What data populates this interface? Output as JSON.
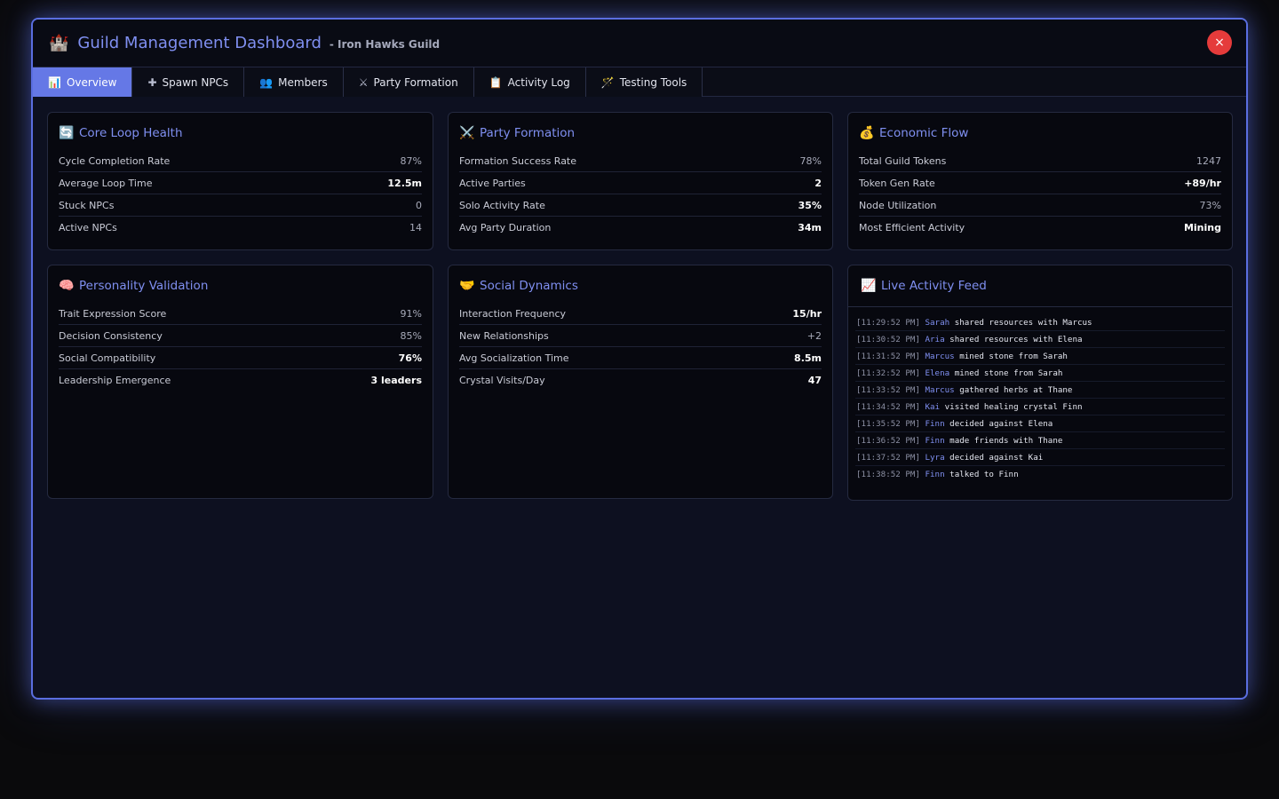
{
  "header": {
    "title": "Guild Management Dashboard",
    "subtitle": "- Iron Hawks Guild",
    "close_label": "×"
  },
  "tabs": [
    {
      "label": "Overview",
      "icon": "chart-icon",
      "active": true
    },
    {
      "label": "Spawn NPCs",
      "icon": "plus-icon"
    },
    {
      "label": "Members",
      "icon": "members-icon"
    },
    {
      "label": "Party Formation",
      "icon": "swords-icon"
    },
    {
      "label": "Activity Log",
      "icon": "clipboard-icon"
    },
    {
      "label": "Testing Tools",
      "icon": "wand-icon"
    }
  ],
  "cards": {
    "core_loop": {
      "title": "Core Loop Health",
      "metrics": [
        {
          "label": "Cycle Completion Rate",
          "value": "87%"
        },
        {
          "label": "Average Loop Time",
          "value": "12.5m"
        },
        {
          "label": "Stuck NPCs",
          "value": "0"
        },
        {
          "label": "Active NPCs",
          "value": "14"
        }
      ]
    },
    "party": {
      "title": "Party Formation",
      "metrics": [
        {
          "label": "Formation Success Rate",
          "value": "78%"
        },
        {
          "label": "Active Parties",
          "value": "2"
        },
        {
          "label": "Solo Activity Rate",
          "value": "35%"
        },
        {
          "label": "Avg Party Duration",
          "value": "34m"
        }
      ]
    },
    "economic": {
      "title": "Economic Flow",
      "metrics": [
        {
          "label": "Total Guild Tokens",
          "value": "1247"
        },
        {
          "label": "Token Gen Rate",
          "value": "+89/hr"
        },
        {
          "label": "Node Utilization",
          "value": "73%"
        },
        {
          "label": "Most Efficient Activity",
          "value": "Mining"
        }
      ]
    },
    "personality": {
      "title": "Personality Validation",
      "metrics": [
        {
          "label": "Trait Expression Score",
          "value": "91%"
        },
        {
          "label": "Decision Consistency",
          "value": "85%"
        },
        {
          "label": "Social Compatibility",
          "value": "76%"
        },
        {
          "label": "Leadership Emergence",
          "value": "3 leaders"
        }
      ]
    },
    "social": {
      "title": "Social Dynamics",
      "metrics": [
        {
          "label": "Interaction Frequency",
          "value": "15/hr"
        },
        {
          "label": "New Relationships",
          "value": "+2"
        },
        {
          "label": "Avg Socialization Time",
          "value": "8.5m"
        },
        {
          "label": "Crystal Visits/Day",
          "value": "47"
        }
      ]
    },
    "feed": {
      "title": "Live Activity Feed",
      "entries": [
        {
          "time": "[11:29:52 PM]",
          "who": "Sarah",
          "text": "shared resources with Marcus"
        },
        {
          "time": "[11:30:52 PM]",
          "who": "Aria",
          "text": "shared resources with Elena"
        },
        {
          "time": "[11:31:52 PM]",
          "who": "Marcus",
          "text": "mined stone from Sarah"
        },
        {
          "time": "[11:32:52 PM]",
          "who": "Elena",
          "text": "mined stone from Sarah"
        },
        {
          "time": "[11:33:52 PM]",
          "who": "Marcus",
          "text": "gathered herbs at Thane"
        },
        {
          "time": "[11:34:52 PM]",
          "who": "Kai",
          "text": "visited healing crystal Finn"
        },
        {
          "time": "[11:35:52 PM]",
          "who": "Finn",
          "text": "decided against Elena"
        },
        {
          "time": "[11:36:52 PM]",
          "who": "Finn",
          "text": "made friends with Thane"
        },
        {
          "time": "[11:37:52 PM]",
          "who": "Lyra",
          "text": "decided against Kai"
        },
        {
          "time": "[11:38:52 PM]",
          "who": "Finn",
          "text": "talked to Finn"
        }
      ]
    }
  },
  "colors": {
    "accent": "#7f8ff0",
    "border_glow": "#5a6ee0",
    "close": "#e53b3b",
    "active_tab": "#6578e6"
  }
}
